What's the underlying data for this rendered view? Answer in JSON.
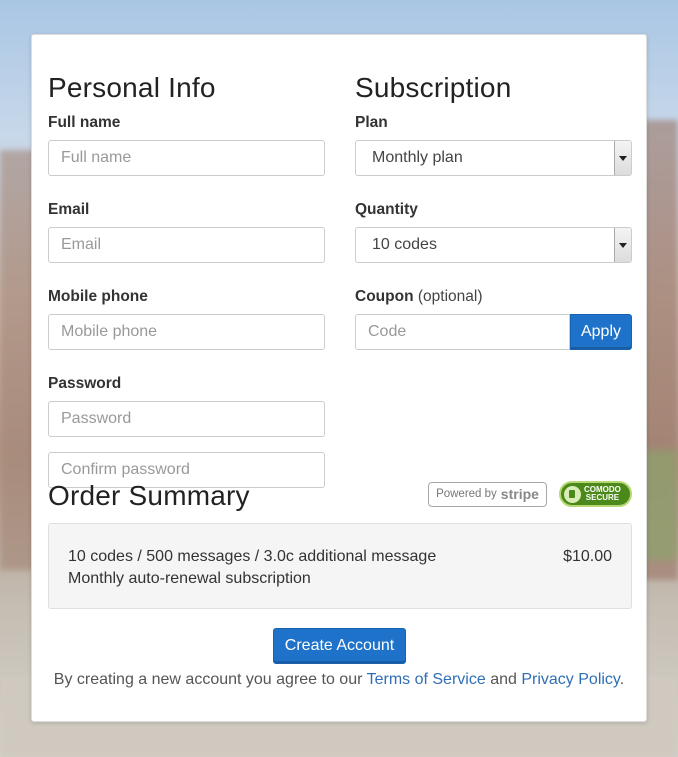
{
  "personal": {
    "heading": "Personal Info",
    "full_name": {
      "label": "Full name",
      "placeholder": "Full name"
    },
    "email": {
      "label": "Email",
      "placeholder": "Email"
    },
    "mobile": {
      "label": "Mobile phone",
      "placeholder": "Mobile phone"
    },
    "password": {
      "label": "Password",
      "placeholder": "Password",
      "confirm_placeholder": "Confirm password"
    }
  },
  "subscription": {
    "heading": "Subscription",
    "plan": {
      "label": "Plan",
      "value": "Monthly plan"
    },
    "quantity": {
      "label": "Quantity",
      "value": "10 codes"
    },
    "coupon": {
      "label": "Coupon",
      "optional": "(optional)",
      "placeholder": "Code",
      "apply_label": "Apply"
    }
  },
  "order": {
    "heading": "Order Summary",
    "badges": {
      "stripe_prefix": "Powered by",
      "stripe_name": "stripe",
      "comodo_line1": "COMODO",
      "comodo_line2": "SECURE"
    },
    "line1": "10 codes / 500 messages / 3.0c additional message",
    "line2": "Monthly auto-renewal subscription",
    "price": "$10.00"
  },
  "actions": {
    "create_label": "Create Account",
    "terms_prefix": "By creating a new account you agree to our",
    "terms_link": "Terms of Service",
    "and": "and",
    "privacy_link": "Privacy Policy",
    "period": "."
  },
  "colors": {
    "accent": "#1e72c9",
    "link": "#2f6fb5",
    "summary_bg": "#f5f5f5"
  }
}
